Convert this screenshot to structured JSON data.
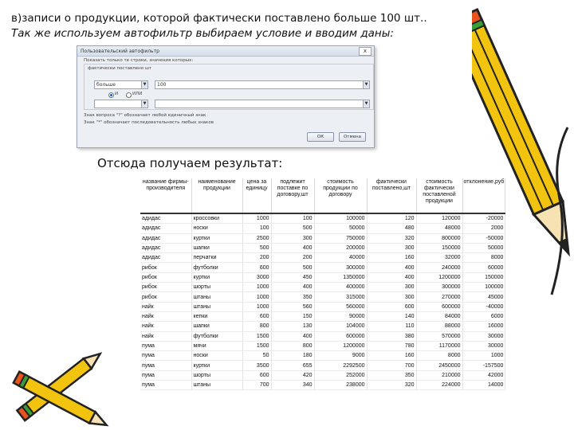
{
  "heading": {
    "line1": "в)записи о продукции, которой фактически поставлено больше 100 шт..",
    "line2_prefix": "Так же используем ",
    "line2_emph": "автофильтр",
    "line2_mid": " выбираем ",
    "line2_emph2": "условие",
    "line2_suffix": " и вводим даны:"
  },
  "dialog": {
    "title": "Пользовательский автофильтр",
    "close_label": "x",
    "show_rows_label": "Показать только те строки, значения которых:",
    "column_label": "фактически поставлено шт",
    "condition1": "больше",
    "value1": "100",
    "and_label": "И",
    "or_label": "ИЛИ",
    "condition2": "",
    "value2": "",
    "hint1": "Знак вопроса \"?\" обозначает любой единичный знак",
    "hint2": "Знак \"*\" обозначает последовательность любых знаков",
    "ok_label": "ОК",
    "cancel_label": "Отмена"
  },
  "result_label": "Отсюда получаем результат:",
  "table": {
    "headers": [
      "название фирмы-производителя",
      "наименование продукции",
      "цена за единицу",
      "подлежит поставке по договору,шт",
      "стоимость продукции по договору",
      "фактически поставлено,шт",
      "стоимость фактически поставленой продукции",
      "отклонение,руб"
    ],
    "rows": [
      [
        "адидас",
        "кроссовки",
        "1000",
        "100",
        "100000",
        "120",
        "120000",
        "-20000"
      ],
      [
        "адидас",
        "носки",
        "100",
        "500",
        "50000",
        "480",
        "48000",
        "2000"
      ],
      [
        "адидас",
        "куртки",
        "2500",
        "300",
        "750000",
        "320",
        "800000",
        "-50000"
      ],
      [
        "адидас",
        "шапки",
        "500",
        "400",
        "200000",
        "300",
        "150000",
        "50000"
      ],
      [
        "адидас",
        "перчатки",
        "200",
        "200",
        "40000",
        "160",
        "32000",
        "8000"
      ],
      [
        "рибок",
        "футболки",
        "600",
        "500",
        "300000",
        "400",
        "240000",
        "60000"
      ],
      [
        "рибок",
        "куртки",
        "3000",
        "450",
        "1350000",
        "400",
        "1200000",
        "150000"
      ],
      [
        "рибок",
        "шорты",
        "1000",
        "400",
        "400000",
        "300",
        "300000",
        "100000"
      ],
      [
        "рибок",
        "штаны",
        "1000",
        "350",
        "315000",
        "300",
        "270000",
        "45000"
      ],
      [
        "найк",
        "штаны",
        "1000",
        "560",
        "560000",
        "600",
        "600000",
        "-40000"
      ],
      [
        "найк",
        "кепки",
        "600",
        "150",
        "90000",
        "140",
        "84000",
        "6000"
      ],
      [
        "найк",
        "шапки",
        "800",
        "130",
        "104000",
        "110",
        "88000",
        "16000"
      ],
      [
        "найк",
        "футболки",
        "1500",
        "400",
        "600000",
        "380",
        "570000",
        "30000"
      ],
      [
        "пума",
        "мячи",
        "1500",
        "800",
        "1200000",
        "780",
        "1170000",
        "30000"
      ],
      [
        "пума",
        "носки",
        "50",
        "180",
        "9000",
        "160",
        "8000",
        "1000"
      ],
      [
        "пума",
        "куртки",
        "3500",
        "655",
        "2292500",
        "700",
        "2450000",
        "-157500"
      ],
      [
        "пума",
        "шорты",
        "600",
        "420",
        "252000",
        "350",
        "210000",
        "42000"
      ],
      [
        "пума",
        "штаны",
        "700",
        "340",
        "238000",
        "320",
        "224000",
        "14000"
      ]
    ]
  },
  "colors": {
    "pencil_body": "#f2c40f",
    "pencil_outline": "#222222",
    "pencil_eraser": "#e8531f",
    "pencil_band": "#3a9d3a"
  }
}
